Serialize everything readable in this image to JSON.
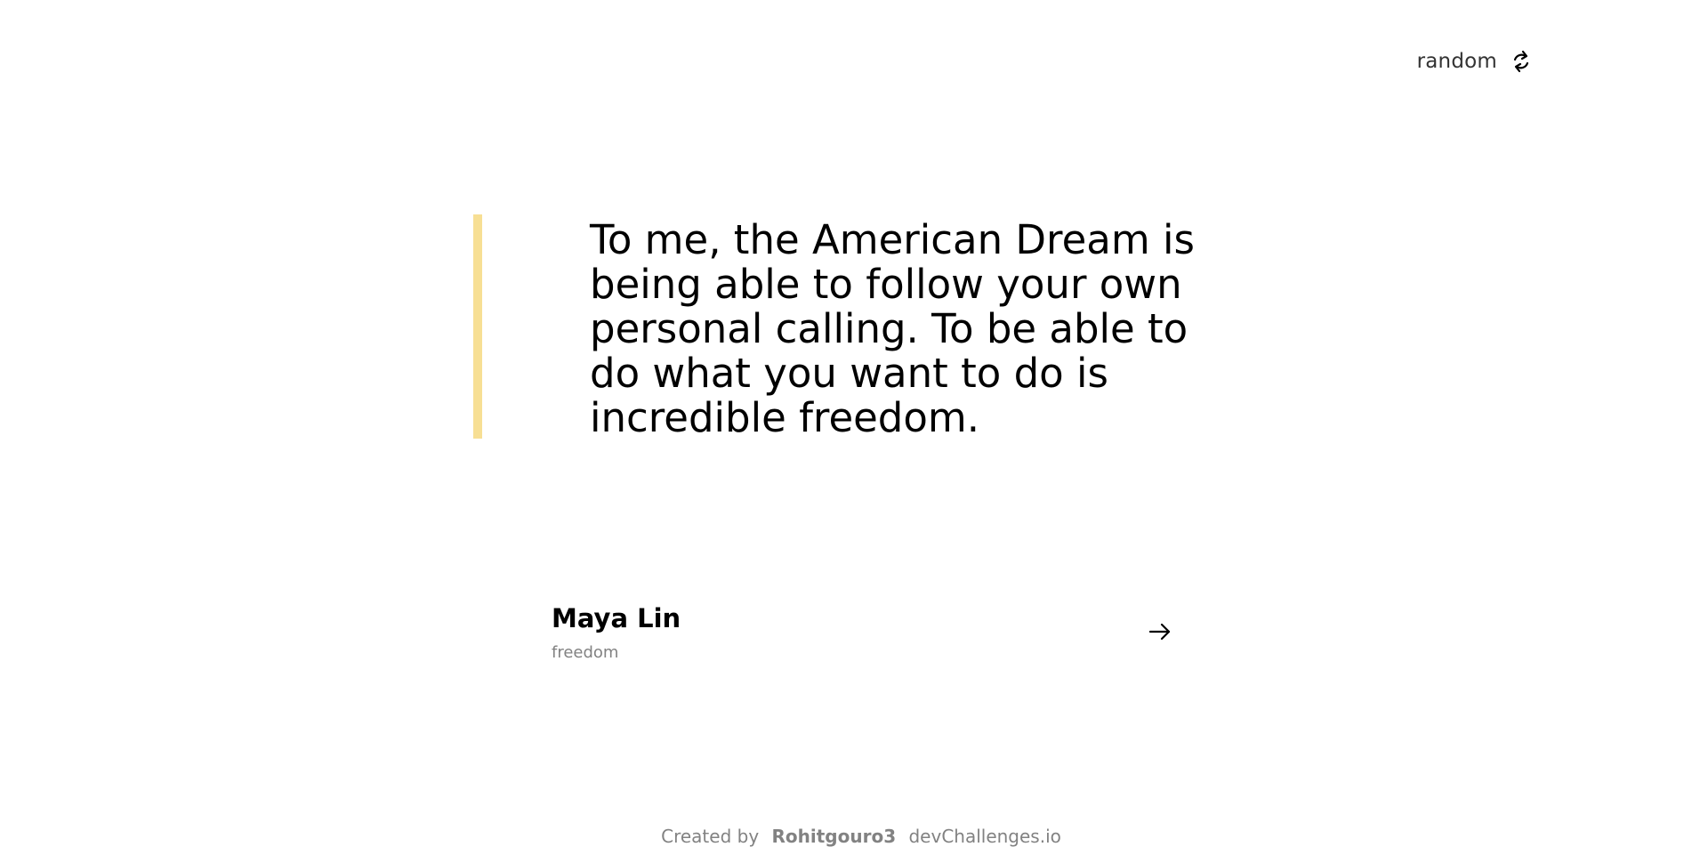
{
  "header": {
    "random_label": "random",
    "random_icon": "refresh-icon"
  },
  "quote": {
    "text": "To me, the American Dream is being able to follow your own personal calling. To be able to do what you want to do is incredible freedom.",
    "accent_color": "#f7df94"
  },
  "author": {
    "name": "Maya Lin",
    "genre": "freedom",
    "arrow_icon": "arrow-right-icon"
  },
  "footer": {
    "created_by": "Created by",
    "author": "Rohitgouro3",
    "site": "devChallenges.io"
  }
}
